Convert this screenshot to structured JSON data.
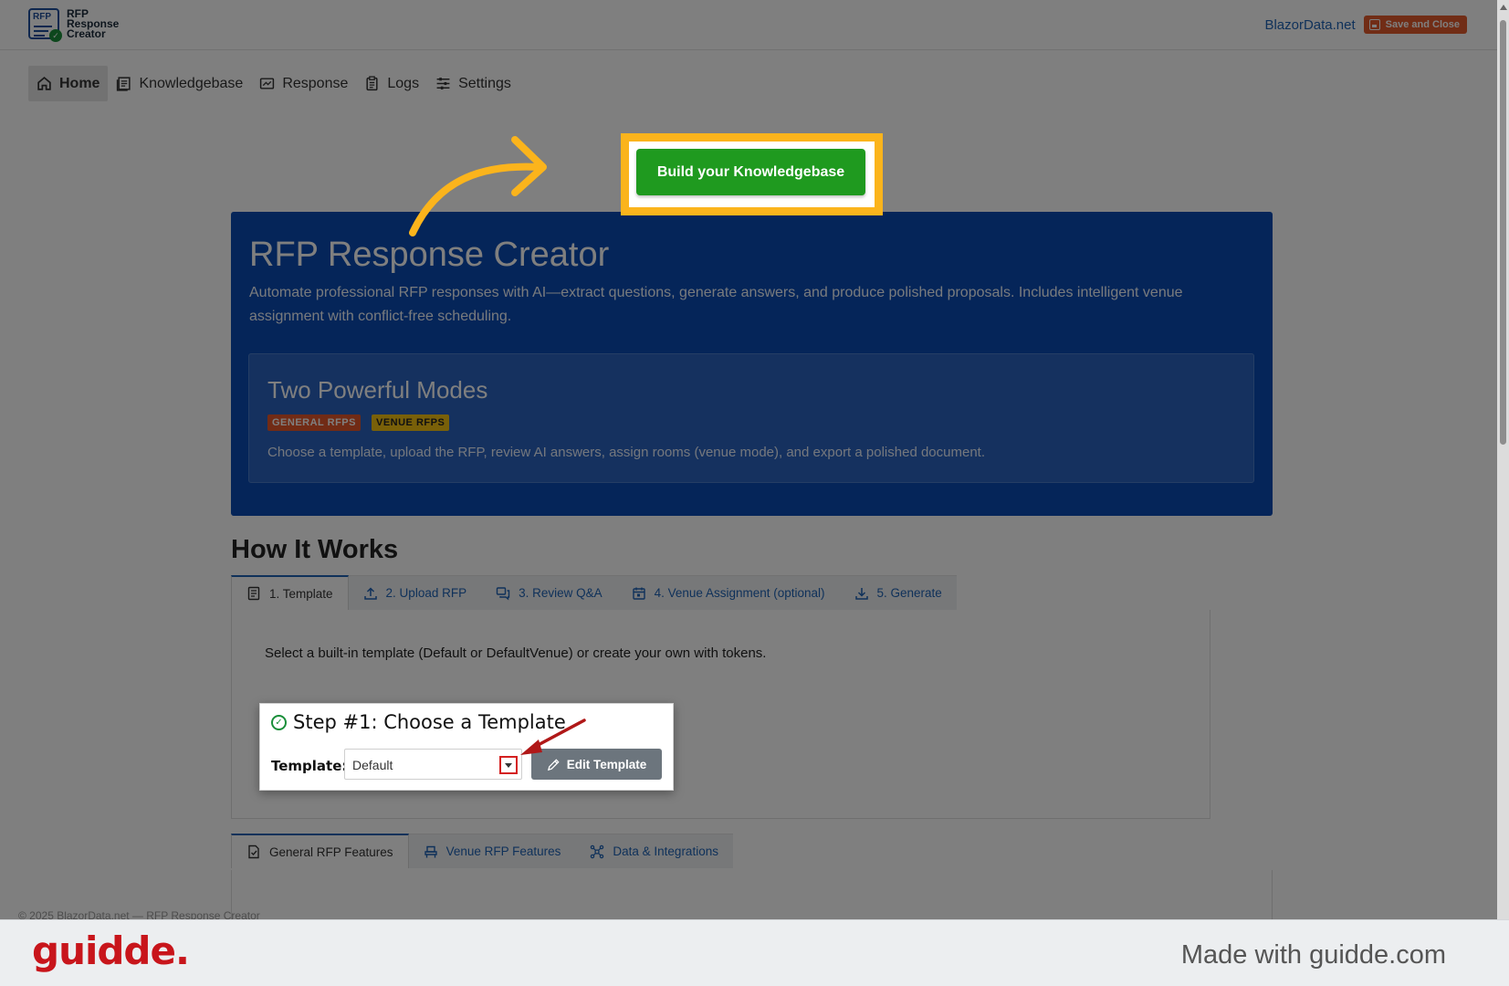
{
  "header": {
    "logo_lines": [
      "RFP",
      "Response",
      "Creator"
    ],
    "logo_mark_text": "RFP",
    "site_link": "BlazorData.net",
    "save_close_label": "Save and Close"
  },
  "nav": {
    "items": [
      {
        "label": "Home",
        "icon": "home-icon",
        "active": true
      },
      {
        "label": "Knowledgebase",
        "icon": "book-icon"
      },
      {
        "label": "Response",
        "icon": "response-icon"
      },
      {
        "label": "Logs",
        "icon": "clipboard-icon"
      },
      {
        "label": "Settings",
        "icon": "sliders-icon"
      }
    ]
  },
  "cta": {
    "label": "Build your Knowledgebase"
  },
  "hero": {
    "title": "RFP Response Creator",
    "description": "Automate professional RFP responses with AI—extract questions, generate answers, and produce polished proposals. Includes intelligent venue assignment with conflict-free scheduling.",
    "modes_title": "Two Powerful Modes",
    "badges": [
      "GENERAL RFPS",
      "VENUE RFPS"
    ],
    "modes_desc": "Choose a template, upload the RFP, review AI answers, assign rooms (venue mode), and export a polished document."
  },
  "how_it_works": {
    "title": "How It Works",
    "tabs": [
      {
        "label": "1. Template",
        "icon": "document-icon",
        "active": true
      },
      {
        "label": "2. Upload RFP",
        "icon": "upload-icon"
      },
      {
        "label": "3. Review Q&A",
        "icon": "chat-icon"
      },
      {
        "label": "4. Venue Assignment (optional)",
        "icon": "calendar-icon"
      },
      {
        "label": "5. Generate",
        "icon": "download-icon"
      }
    ],
    "panel_text": "Select a built-in template (Default or DefaultVenue) or create your own with tokens.",
    "step": {
      "title": "Step #1: Choose a Template",
      "template_label": "Template:",
      "template_value": "Default",
      "edit_label": "Edit Template"
    }
  },
  "features": {
    "tabs": [
      {
        "label": "General RFP Features",
        "icon": "file-check-icon",
        "active": true
      },
      {
        "label": "Venue RFP Features",
        "icon": "chair-icon"
      },
      {
        "label": "Data & Integrations",
        "icon": "network-icon"
      }
    ]
  },
  "footer": {
    "faint_text": "© 2025 BlazorData.net — RFP Response Creator"
  },
  "guidde": {
    "logo": "guidde.",
    "tagline": "Made with guidde.com"
  },
  "colors": {
    "hero_blue": "#0a4bb3",
    "cta_green": "#1f9a1f",
    "highlight_orange": "#fbb41c",
    "arrow_red": "#b01818",
    "guidde_red": "#c8151b"
  }
}
